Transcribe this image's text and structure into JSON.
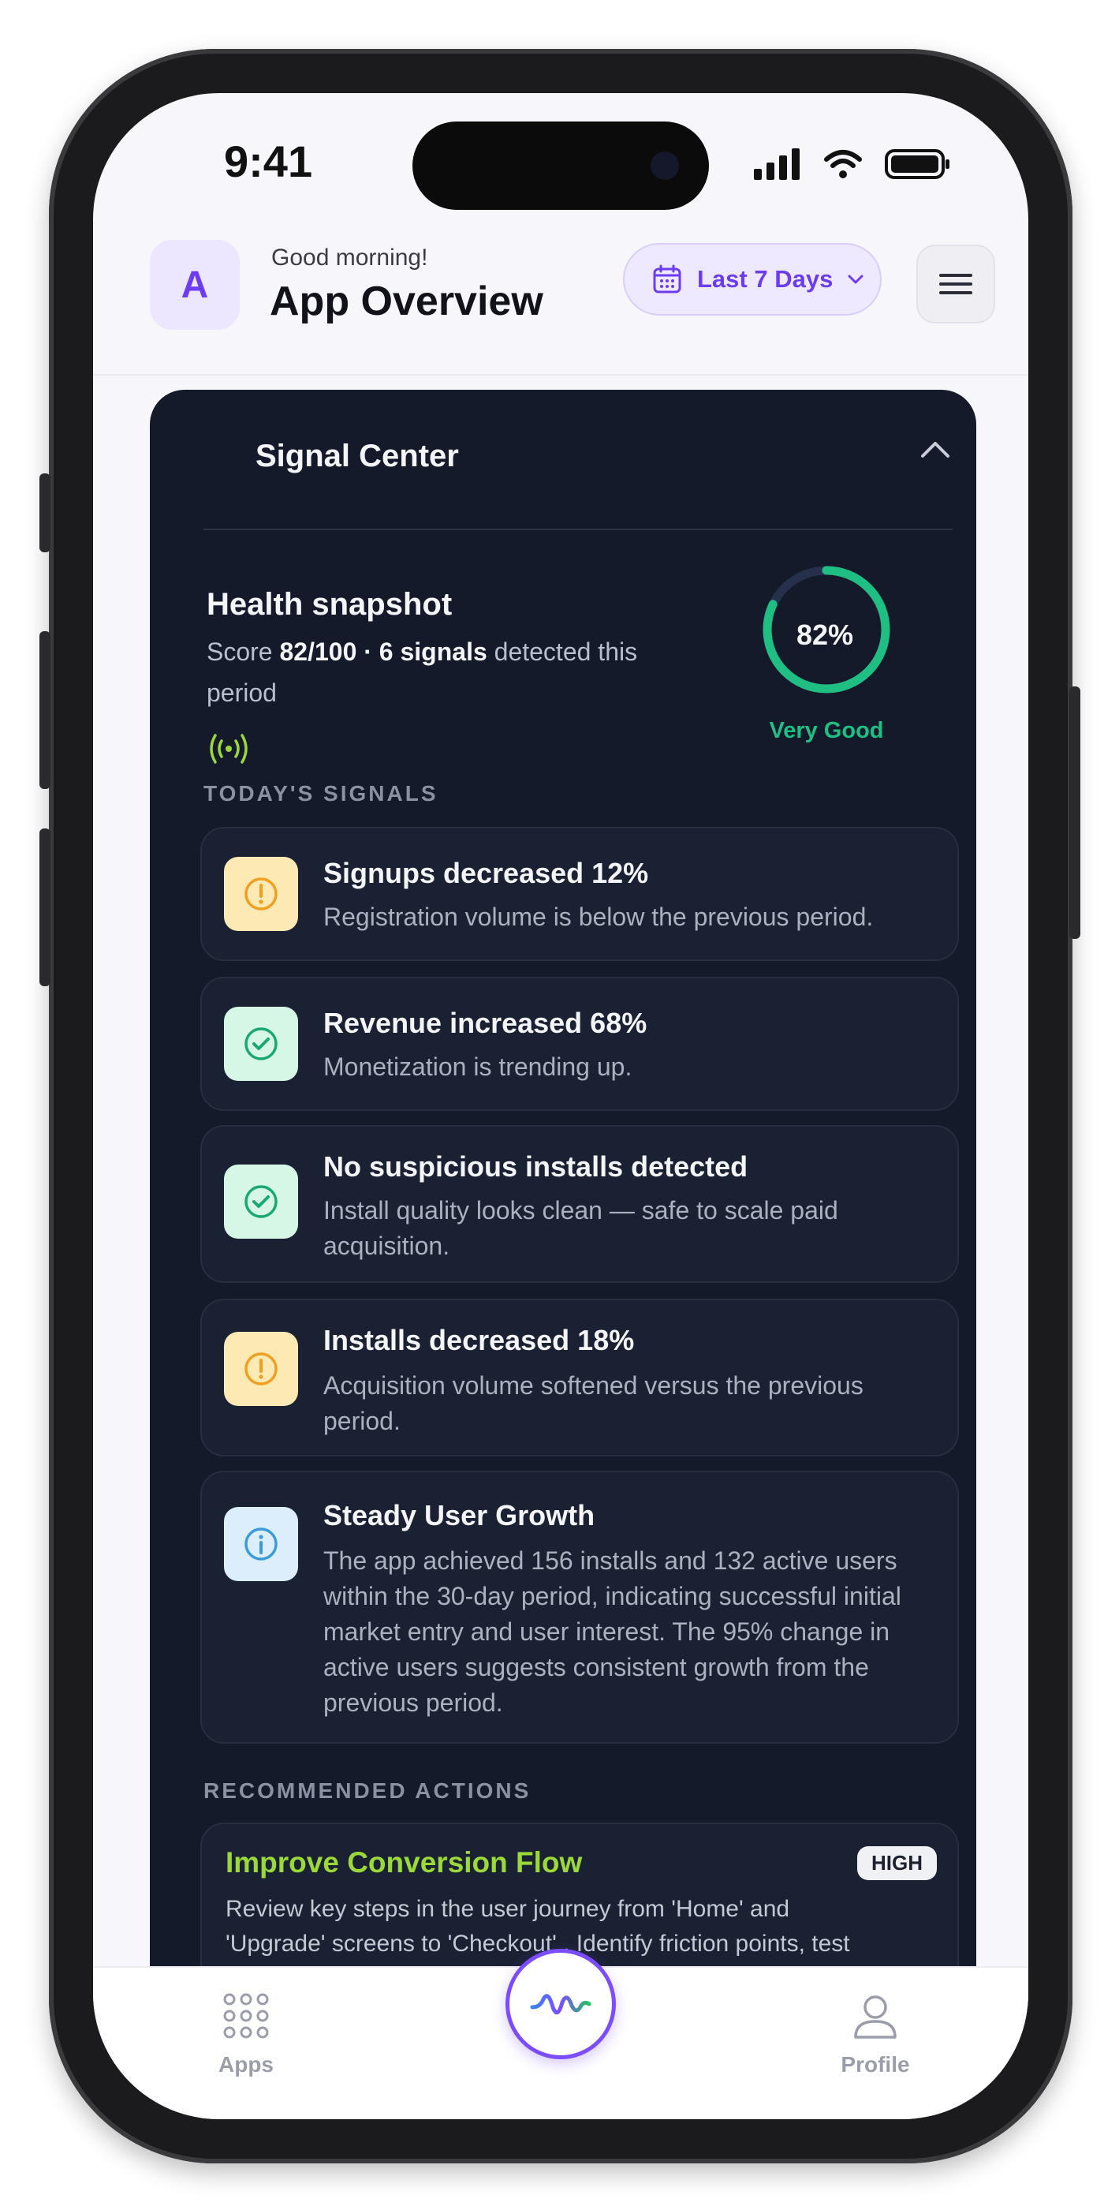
{
  "status_bar": {
    "time": "9:41"
  },
  "header": {
    "avatar_letter": "A",
    "greeting": "Good morning!",
    "title": "App Overview",
    "date_range": "Last 7 Days"
  },
  "signal_center": {
    "title": "Signal Center",
    "health": {
      "title": "Health snapshot",
      "score_prefix": "Score",
      "score": "82/100",
      "separator": "·",
      "signals": "6 signals",
      "suffix": "detected this period",
      "percent": "82%",
      "percent_value": 0.82,
      "rating": "Very Good"
    },
    "todays_label": "TODAY'S SIGNALS",
    "signals": [
      {
        "title": "Signups decreased 12%",
        "desc": "Registration volume is below the previous period.",
        "icon": "warning-icon",
        "kind": "warning"
      },
      {
        "title": "Revenue increased 68%",
        "desc": "Monetization is trending up.",
        "icon": "check-icon",
        "kind": "success"
      },
      {
        "title": "No suspicious installs detected",
        "desc": "Install quality looks clean — safe to scale paid acquisition.",
        "icon": "check-icon",
        "kind": "success"
      },
      {
        "title": "Installs decreased 18%",
        "desc": "Acquisition volume softened versus the previous period.",
        "icon": "warning-icon",
        "kind": "warning"
      },
      {
        "title": "Steady User Growth",
        "desc": "The app achieved 156 installs and 132 active users within the 30-day period, indicating successful initial market entry and user interest. The 95% change in active users suggests consistent growth from the previous period.",
        "icon": "info-icon",
        "kind": "info"
      }
    ],
    "actions_label": "RECOMMENDED ACTIONS",
    "action": {
      "title": "Improve Conversion Flow",
      "badge": "HIGH",
      "desc": "Review key steps in the user journey from 'Home' and 'Upgrade' screens to 'Checkout' . Identify friction points, test alternative pricing models, and optimize in-app messaging to increase conversion rate."
    }
  },
  "tabbar": {
    "apps": "Apps",
    "profile": "Profile"
  },
  "colors": {
    "accent": "#6b3cf0",
    "success": "#1fbf84",
    "warning": "#f0a020",
    "info": "#3b9bd8",
    "card": "#141a2a"
  }
}
